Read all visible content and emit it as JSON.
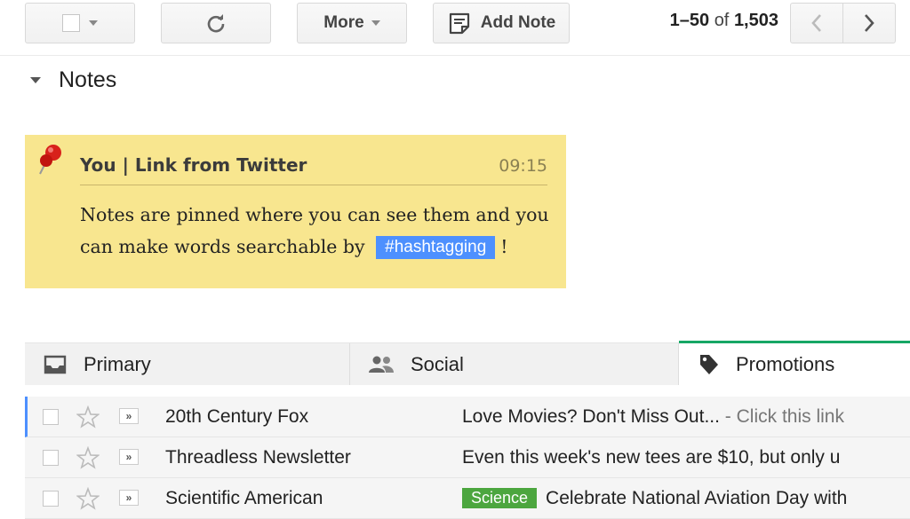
{
  "toolbar": {
    "more_label": "More",
    "add_note_label": "Add Note",
    "pager": {
      "range": "1–50",
      "of": "of",
      "total": "1,503"
    }
  },
  "notes": {
    "section_title": "Notes",
    "card": {
      "author": "You | Link from Twitter",
      "time": "09:15",
      "body_before": "Notes are pinned where you can see them and you can make words searchable by",
      "hashtag": "#hashtagging",
      "body_after": "!",
      "background_color": "#f8e68f"
    }
  },
  "tabs": [
    {
      "label": "Primary",
      "icon": "inbox-icon",
      "active": false
    },
    {
      "label": "Social",
      "icon": "people-icon",
      "active": false
    },
    {
      "label": "Promotions",
      "icon": "tag-icon",
      "active": true
    }
  ],
  "emails": [
    {
      "sender": "20th Century Fox",
      "label": "",
      "subject": "Love Movies? Don't Miss Out...",
      "snippet": " - Click this link"
    },
    {
      "sender": "Threadless Newsletter",
      "label": "",
      "subject": "Even this week's new tees are $10, but only u",
      "snippet": ""
    },
    {
      "sender": "Scientific American",
      "label": "Science",
      "subject": "Celebrate National Aviation Day with",
      "snippet": ""
    }
  ],
  "colors": {
    "accent_blue": "#4d90fe",
    "promotions_green": "#16a765",
    "science_label": "#4ca63f"
  }
}
